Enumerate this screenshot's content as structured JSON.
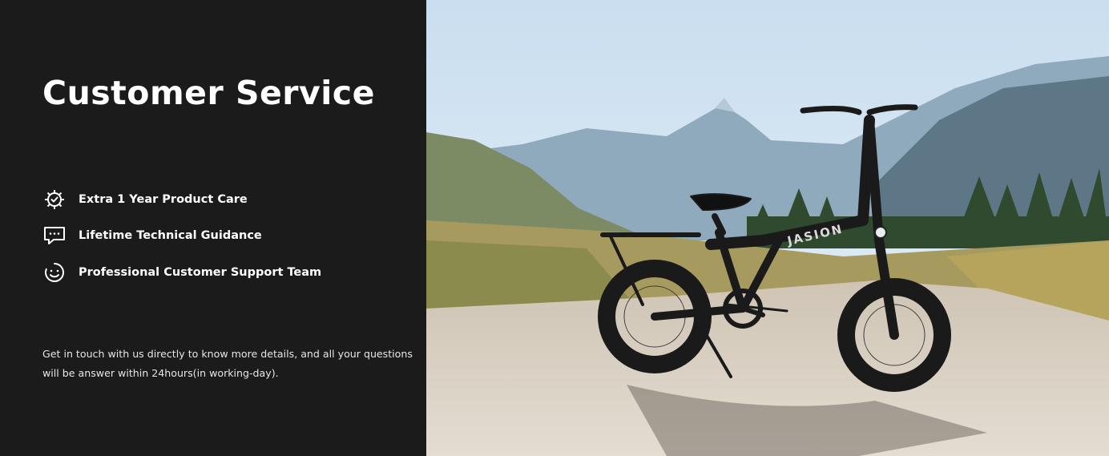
{
  "banner": {
    "title": "Customer Service",
    "features": [
      {
        "icon": "gear-check-icon",
        "label": "Extra 1 Year Product Care"
      },
      {
        "icon": "chat-bubble-icon",
        "label": "Lifetime Technical Guidance"
      },
      {
        "icon": "smiley-support-icon",
        "label": "Professional Customer Support Team"
      }
    ],
    "description": "Get in touch with us directly to know more details, and all your questions will be answer within 24hours(in working-day).",
    "bike_brand": "JASION"
  },
  "colors": {
    "panel_bg": "#1b1b1b",
    "text": "#ffffff",
    "brand_accent": "#e87a2a"
  }
}
